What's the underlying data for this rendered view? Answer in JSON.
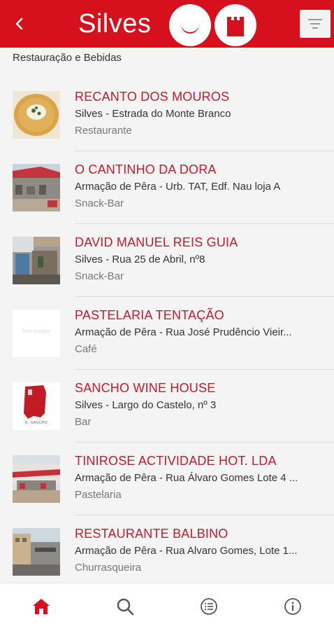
{
  "header": {
    "back_label": "<",
    "title": "Silves",
    "brand_color": "#d6111d"
  },
  "section_title": "Restauração e Bebidas",
  "items": [
    {
      "name": "RECANTO DOS MOUROS",
      "address": "Silves - Estrada do Monte Branco",
      "category": "Restaurante"
    },
    {
      "name": "O CANTINHO DA DORA",
      "address": "Armação de Pêra - Urb. TAT, Edf. Nau loja A",
      "category": "Snack-Bar"
    },
    {
      "name": "DAVID MANUEL REIS GUIA",
      "address": "Silves - Rua 25 de Abril, nº8",
      "category": "Snack-Bar"
    },
    {
      "name": "PASTELARIA TENTAÇÃO",
      "address": "Armação de Pêra - Rua José Prudêncio Vieir...",
      "category": "Café",
      "image_text": "Sem imagem"
    },
    {
      "name": "SANCHO WINE HOUSE",
      "address": "Silves - Largo do Castelo, nº 3",
      "category": "Bar",
      "image_text": "D. SANCHO"
    },
    {
      "name": "TINIROSE ACTIVIDADE HOT. LDA",
      "address": "Armação de Pêra - Rua Álvaro Gomes Lote 4 ...",
      "category": "Pastelaria"
    },
    {
      "name": "RESTAURANTE BALBINO",
      "address": "Armação de Pêra - Rua Alvaro Gomes, Lote 1...",
      "category": "Churrasqueira"
    }
  ],
  "bottom_nav": {
    "home_icon": "home-icon",
    "search_icon": "search-icon",
    "list_icon": "list-icon",
    "info_icon": "info-icon",
    "active_color": "#d6111d"
  }
}
